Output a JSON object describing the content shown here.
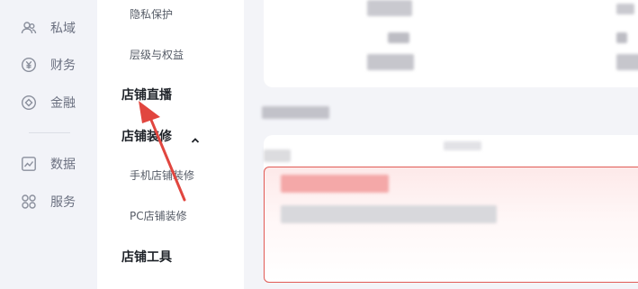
{
  "rail": {
    "items": [
      {
        "label": "私域",
        "icon": "private-domain-icon"
      },
      {
        "label": "财务",
        "icon": "yuan-icon"
      },
      {
        "label": "金融",
        "icon": "finance-icon"
      },
      {
        "label": "数据",
        "icon": "chart-icon"
      },
      {
        "label": "服务",
        "icon": "grid-apps-icon"
      }
    ]
  },
  "subnav": {
    "privacy": "隐私保护",
    "level_rights": "层级与权益",
    "live": "店铺直播",
    "decoration": "店铺装修",
    "mobile_decoration": "手机店铺装修",
    "pc_decoration": "PC店铺装修",
    "tools": "店铺工具"
  },
  "colors": {
    "accent_red": "#e1463f",
    "rail_bg": "#f2f3f8",
    "panel_bg": "#ffffff",
    "text_dark": "#1f2329",
    "text_muted": "#6b7080"
  }
}
